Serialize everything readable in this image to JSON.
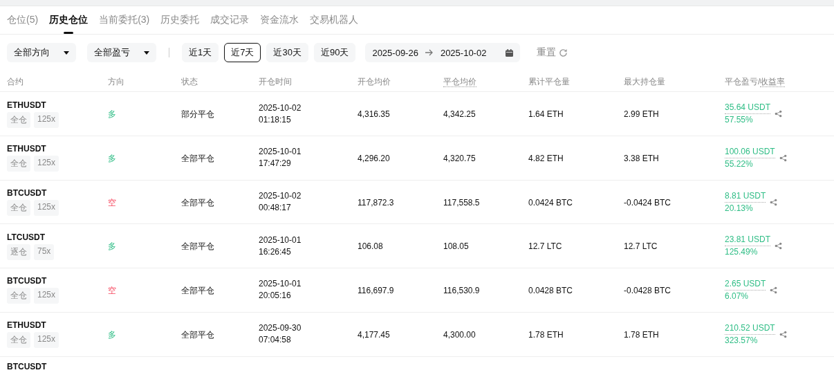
{
  "tabs": [
    {
      "label": "仓位(5)",
      "selected": false
    },
    {
      "label": "历史仓位",
      "selected": true
    },
    {
      "label": "当前委托(3)",
      "selected": false
    },
    {
      "label": "历史委托",
      "selected": false
    },
    {
      "label": "成交记录",
      "selected": false
    },
    {
      "label": "资金流水",
      "selected": false
    },
    {
      "label": "交易机器人",
      "selected": false
    }
  ],
  "filters": {
    "selects": [
      "全部方向",
      "全部盈亏"
    ],
    "periods": [
      {
        "label": "近1天",
        "selected": false
      },
      {
        "label": "近7天",
        "selected": true
      },
      {
        "label": "近30天",
        "selected": false
      },
      {
        "label": "近90天",
        "selected": false
      }
    ],
    "date_from": "2025-09-26",
    "date_to": "2025-10-02",
    "reset": "重置"
  },
  "columns": [
    {
      "parts": [
        {
          "text": "合约",
          "dotted": false
        }
      ]
    },
    {
      "parts": [
        {
          "text": "方向",
          "dotted": false
        }
      ]
    },
    {
      "parts": [
        {
          "text": "状态",
          "dotted": false
        }
      ]
    },
    {
      "parts": [
        {
          "text": "开仓时间",
          "dotted": false
        }
      ]
    },
    {
      "parts": [
        {
          "text": "开仓均价",
          "dotted": false
        }
      ]
    },
    {
      "parts": [
        {
          "text": "平仓均价",
          "dotted": true
        }
      ]
    },
    {
      "parts": [
        {
          "text": "累计平仓量",
          "dotted": false
        }
      ]
    },
    {
      "parts": [
        {
          "text": "最大持仓量",
          "dotted": false
        }
      ]
    },
    {
      "parts": [
        {
          "text": "平仓盈亏/",
          "dotted": false
        },
        {
          "text": "收益率",
          "dotted": true
        }
      ]
    }
  ],
  "rows": [
    {
      "contract": "ETHUSDT",
      "margin": "全仓",
      "leverage": "125x",
      "kind": "long",
      "direction": "多",
      "status": "部分平仓",
      "open_date": "2025-10-02",
      "open_time": "01:18:15",
      "open_price": "4,316.35",
      "close_price": "4,342.25",
      "closed_qty": "1.64 ETH",
      "max_qty": "2.99 ETH",
      "pnl": "35.64 USDT",
      "pnl_rate": "57.55%",
      "profit": true
    },
    {
      "contract": "ETHUSDT",
      "margin": "全仓",
      "leverage": "125x",
      "kind": "long",
      "direction": "多",
      "status": "全部平仓",
      "open_date": "2025-10-01",
      "open_time": "17:47:29",
      "open_price": "4,296.20",
      "close_price": "4,320.75",
      "closed_qty": "4.82 ETH",
      "max_qty": "3.38 ETH",
      "pnl": "100.06 USDT",
      "pnl_rate": "55.22%",
      "profit": true
    },
    {
      "contract": "BTCUSDT",
      "margin": "全仓",
      "leverage": "125x",
      "kind": "short",
      "direction": "空",
      "status": "全部平仓",
      "open_date": "2025-10-02",
      "open_time": "00:48:17",
      "open_price": "117,872.3",
      "close_price": "117,558.5",
      "closed_qty": "0.0424 BTC",
      "max_qty": "-0.0424 BTC",
      "pnl": "8.81 USDT",
      "pnl_rate": "20.13%",
      "profit": true
    },
    {
      "contract": "LTCUSDT",
      "margin": "逐仓",
      "leverage": "75x",
      "kind": "long",
      "direction": "多",
      "status": "全部平仓",
      "open_date": "2025-10-01",
      "open_time": "16:26:45",
      "open_price": "106.08",
      "close_price": "108.05",
      "closed_qty": "12.7 LTC",
      "max_qty": "12.7 LTC",
      "pnl": "23.81 USDT",
      "pnl_rate": "125.49%",
      "profit": true
    },
    {
      "contract": "BTCUSDT",
      "margin": "全仓",
      "leverage": "125x",
      "kind": "short",
      "direction": "空",
      "status": "全部平仓",
      "open_date": "2025-10-01",
      "open_time": "20:05:16",
      "open_price": "116,697.9",
      "close_price": "116,530.9",
      "closed_qty": "0.0428 BTC",
      "max_qty": "-0.0428 BTC",
      "pnl": "2.65 USDT",
      "pnl_rate": "6.07%",
      "profit": true
    },
    {
      "contract": "ETHUSDT",
      "margin": "全仓",
      "leverage": "125x",
      "kind": "long",
      "direction": "多",
      "status": "全部平仓",
      "open_date": "2025-09-30",
      "open_time": "07:04:58",
      "open_price": "4,177.45",
      "close_price": "4,300.00",
      "closed_qty": "1.78 ETH",
      "max_qty": "1.78 ETH",
      "pnl": "210.52 USDT",
      "pnl_rate": "323.57%",
      "profit": true
    }
  ],
  "partial_row": {
    "contract": "BTCUSDT"
  }
}
